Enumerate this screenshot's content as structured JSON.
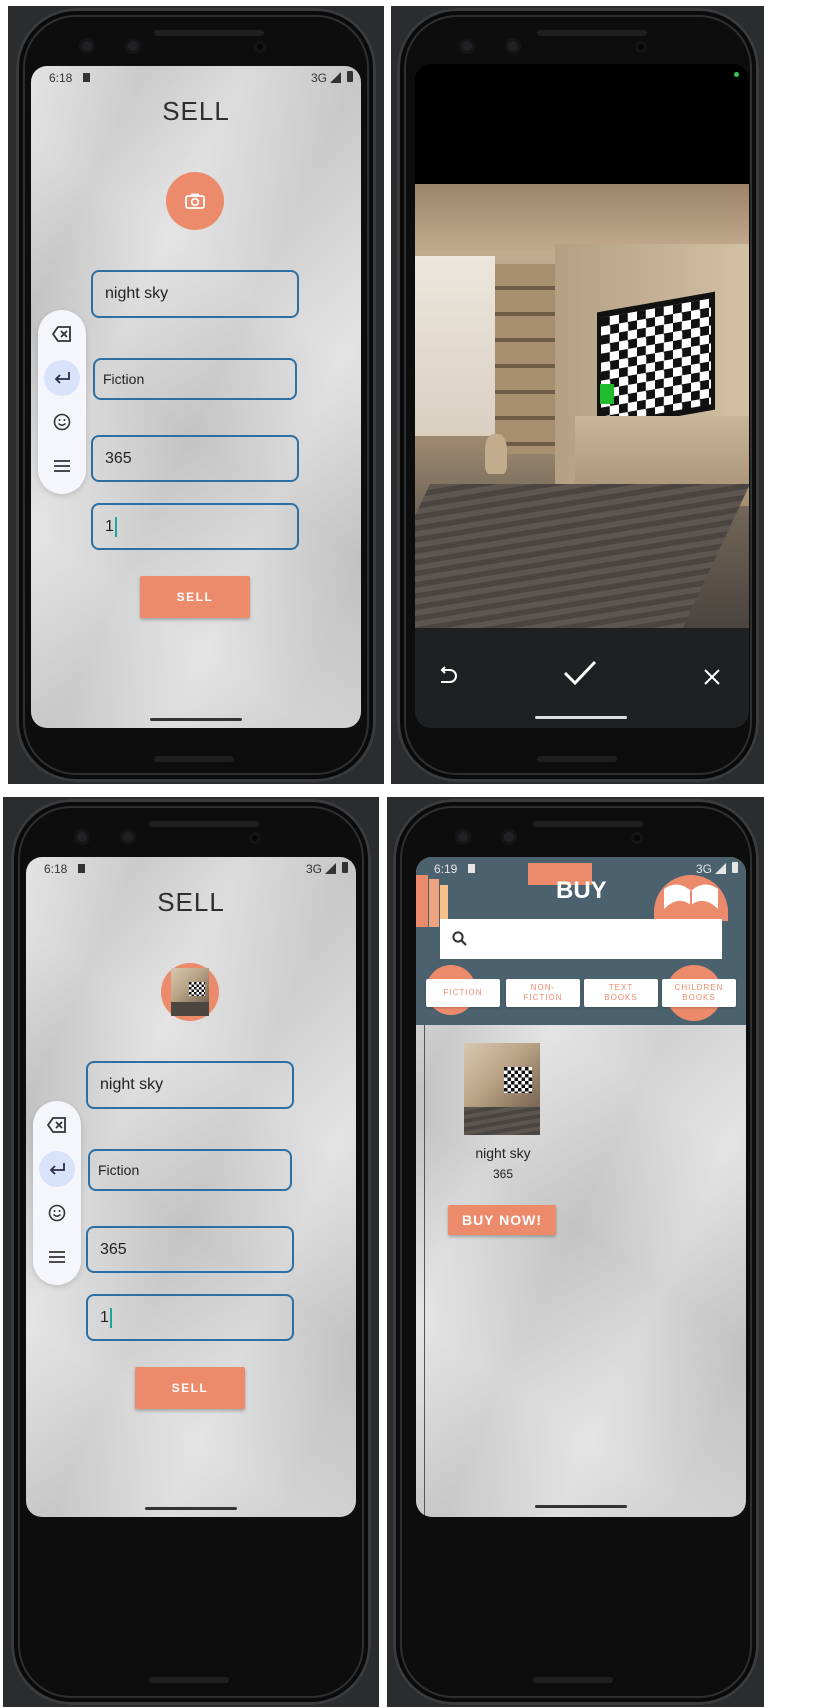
{
  "sell": {
    "title": "SELL",
    "time": "6:18",
    "network": "3G",
    "book_name": "night sky",
    "category": "Fiction",
    "price": "365",
    "quantity": "1",
    "button": "SELL"
  },
  "keyboard_toolbar": {
    "icons": [
      "backspace-icon",
      "enter-icon",
      "emoji-icon",
      "menu-icon"
    ]
  },
  "camera": {
    "controls": [
      "retake-icon",
      "confirm-check-icon",
      "cancel-icon"
    ]
  },
  "buy": {
    "time": "6:19",
    "network": "3G",
    "header_title": "BUY",
    "categories": [
      "FICTION",
      "NON-\nFICTION",
      "TEXT\nBOOKS",
      "CHILDREN\nBOOKS"
    ],
    "item": {
      "name": "night sky",
      "price": "365"
    },
    "buy_now": "BUY NOW!"
  },
  "colors": {
    "accent": "#ec8b6b",
    "field_border": "#2d6fa3",
    "header_bg": "#4b616e",
    "paper": "#d6d6d6"
  }
}
